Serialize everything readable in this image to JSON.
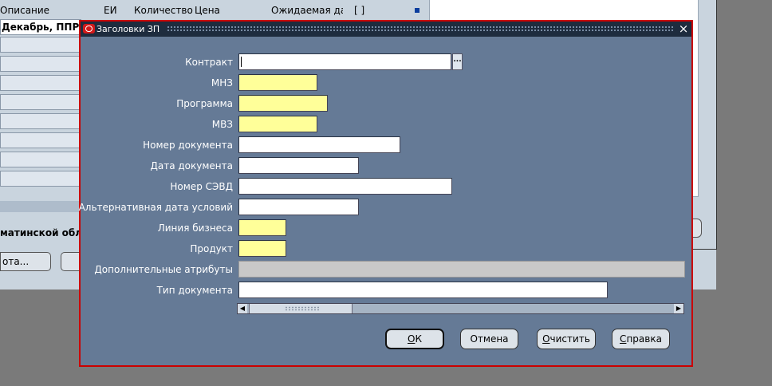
{
  "background": {
    "grid_headers": [
      "Описание",
      "ЕИ",
      "Количество",
      "Цена",
      "Ожидаемая да",
      "[ ]"
    ],
    "row1_text": "Декабрь, ППР на",
    "bold_field_text": "матинской обл.",
    "left_button_label": "ота..."
  },
  "dialog": {
    "title": "Заголовки ЗП",
    "close_icon": "×",
    "fields": [
      {
        "label": "Контракт",
        "value": "",
        "state": "active"
      },
      {
        "label": "МНЗ",
        "value": "",
        "state": "required"
      },
      {
        "label": "Программа",
        "value": "",
        "state": "required"
      },
      {
        "label": "МВЗ",
        "value": "",
        "state": "required"
      },
      {
        "label": "Номер документа",
        "value": "",
        "state": "normal"
      },
      {
        "label": "Дата документа",
        "value": "",
        "state": "normal"
      },
      {
        "label": "Номер СЭВД",
        "value": "",
        "state": "normal"
      },
      {
        "label": "Альтернативная дата условий",
        "value": "",
        "state": "normal"
      },
      {
        "label": "Линия бизнеса",
        "value": "",
        "state": "required"
      },
      {
        "label": "Продукт",
        "value": "",
        "state": "required"
      },
      {
        "label": "Дополнительные атрибуты",
        "value": "",
        "state": "disabled"
      },
      {
        "label": "Тип документа",
        "value": "",
        "state": "normal"
      }
    ],
    "lov_button": "...",
    "buttons": {
      "ok": {
        "underlined": "О",
        "rest": "К"
      },
      "cancel": {
        "underlined": "",
        "rest": "Отмена"
      },
      "clear": {
        "underlined": "О",
        "rest": "чистить"
      },
      "help": {
        "underlined": "С",
        "rest": "правка"
      }
    }
  },
  "colors": {
    "dialog_bg": "#657a96",
    "dialog_border": "#cc0000",
    "required_field": "#ffff99",
    "titlebar": "#1e2c3e"
  }
}
